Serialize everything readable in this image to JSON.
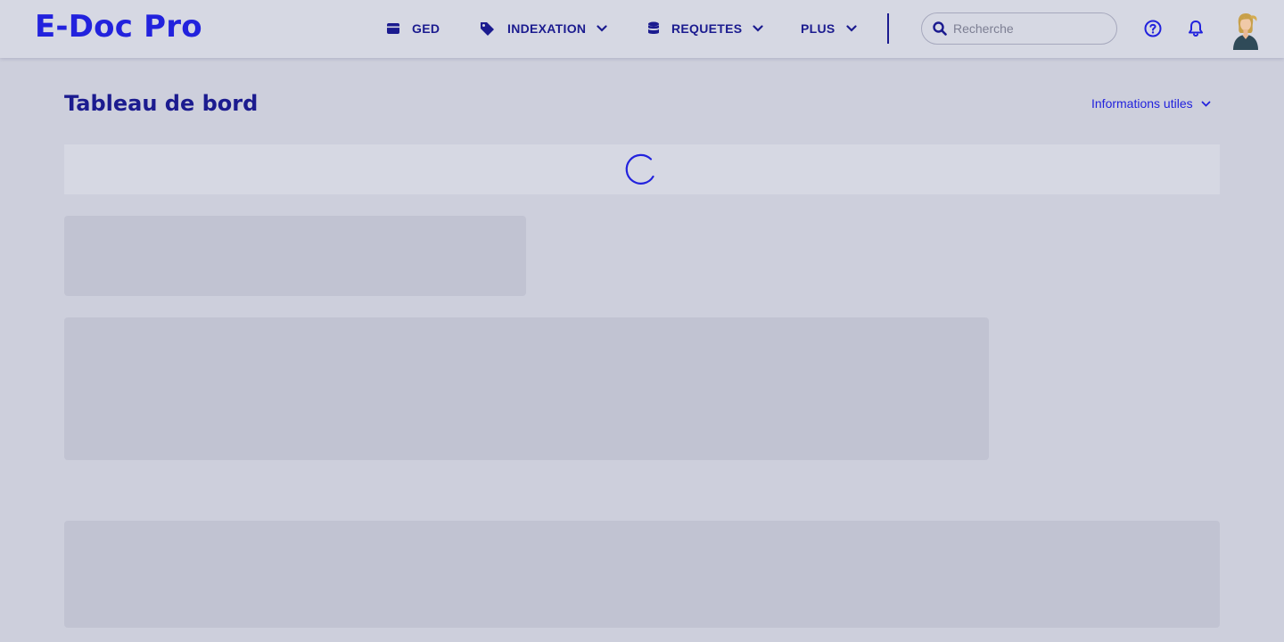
{
  "app": {
    "logo": "E-Doc Pro"
  },
  "nav": {
    "items": [
      {
        "label": "GED",
        "icon": "folder-icon",
        "has_dropdown": false
      },
      {
        "label": "INDEXATION",
        "icon": "tags-icon",
        "has_dropdown": true
      },
      {
        "label": "REQUETES",
        "icon": "database-icon",
        "has_dropdown": true
      },
      {
        "label": "PLUS",
        "icon": "",
        "has_dropdown": true
      }
    ]
  },
  "search": {
    "placeholder": "Recherche",
    "value": ""
  },
  "header_icons": [
    "help-icon",
    "bell-icon",
    "avatar"
  ],
  "page": {
    "title": "Tableau de bord",
    "info_link": "Informations utiles"
  },
  "state": {
    "loading": true
  },
  "colors": {
    "primary": "#2222dd",
    "navy": "#1b1b8f",
    "background": "#cdcfdc",
    "skeleton": "#c1c3d2"
  }
}
